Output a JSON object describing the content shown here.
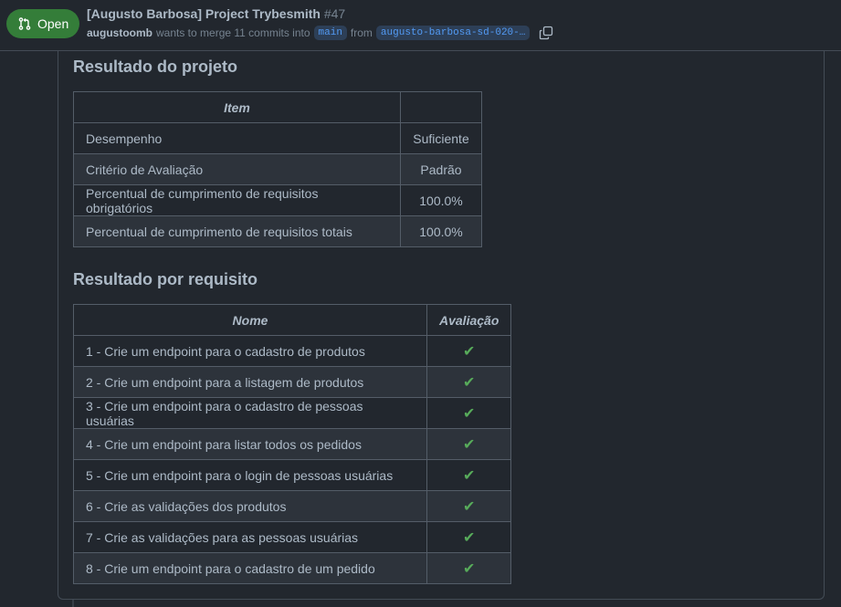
{
  "header": {
    "state_label": "Open",
    "title": "[Augusto Barbosa] Project Trybesmith",
    "number": "#47",
    "author": "augustoomb",
    "merge_text": "wants to merge 11 commits into",
    "base_branch": "main",
    "from_text": "from",
    "head_branch": "augusto-barbosa-sd-020-…"
  },
  "project": {
    "heading": "Resultado do projeto",
    "columns": [
      "Item",
      ""
    ],
    "rows": [
      [
        "Desempenho",
        "Suficiente"
      ],
      [
        "Critério de Avaliação",
        "Padrão"
      ],
      [
        "Percentual de cumprimento de requisitos obrigatórios",
        "100.0%"
      ],
      [
        "Percentual de cumprimento de requisitos totais",
        "100.0%"
      ]
    ]
  },
  "requirements": {
    "heading": "Resultado por requisito",
    "columns": [
      "Nome",
      "Avaliação"
    ],
    "rows": [
      [
        "1 - Crie um endpoint para o cadastro de produtos",
        "✔"
      ],
      [
        "2 - Crie um endpoint para a listagem de produtos",
        "✔"
      ],
      [
        "3 - Crie um endpoint para o cadastro de pessoas usuárias",
        "✔"
      ],
      [
        "4 - Crie um endpoint para listar todos os pedidos",
        "✔"
      ],
      [
        "5 - Crie um endpoint para o login de pessoas usuárias",
        "✔"
      ],
      [
        "6 - Crie as validações dos produtos",
        "✔"
      ],
      [
        "7 - Crie as validações para as pessoas usuárias",
        "✔"
      ],
      [
        "8 - Crie um endpoint para o cadastro de um pedido",
        "✔"
      ]
    ]
  },
  "colors": {
    "background": "#22272e",
    "open_badge": "#347d39",
    "check": "#57ab5a",
    "branch_text": "#539bf5"
  }
}
